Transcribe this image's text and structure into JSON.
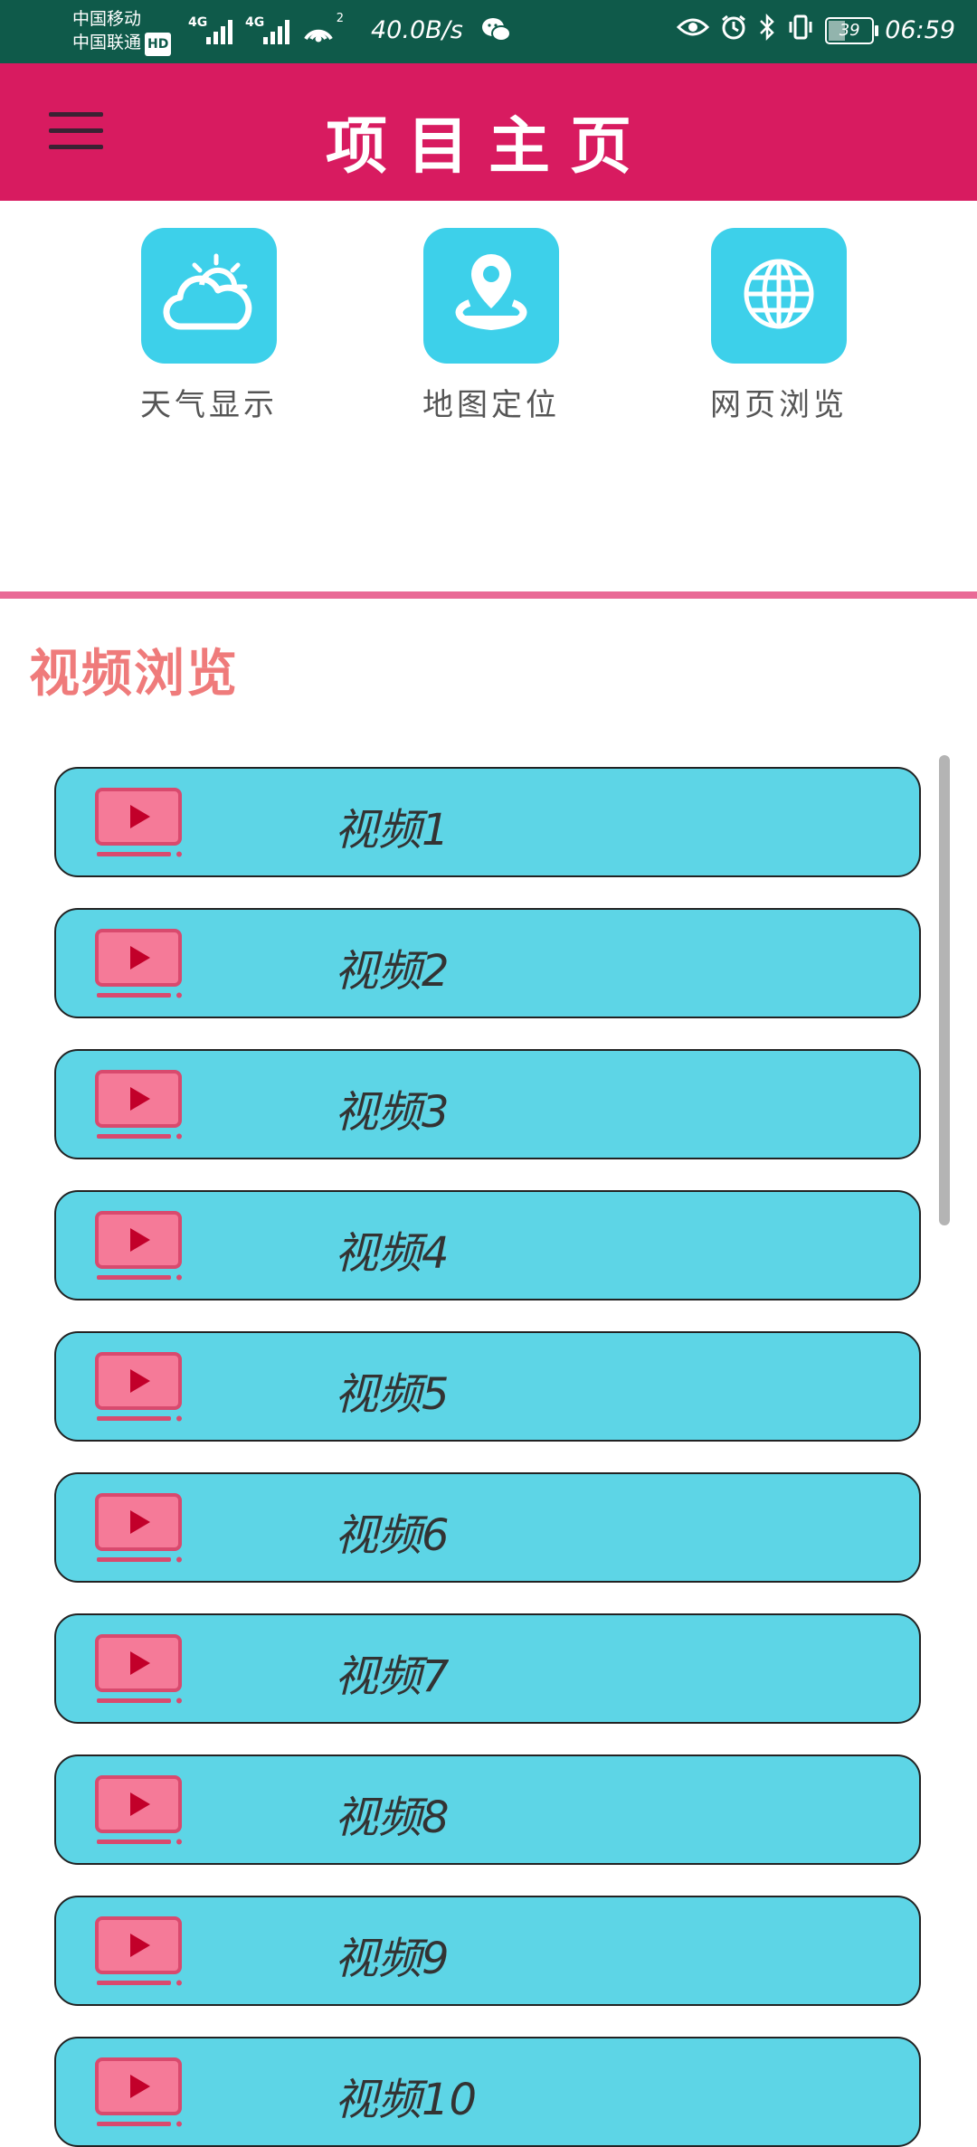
{
  "status_bar": {
    "carrier_1": "中国移动",
    "carrier_2": "中国联通",
    "hd_badge": "HD",
    "network_1": "4G",
    "network_2": "4G",
    "hotspot_count": "2",
    "speed": "40.0B/s",
    "battery": "39",
    "time": "06:59"
  },
  "app_bar": {
    "title": "项目主页"
  },
  "features": [
    {
      "label": "天气显示",
      "icon": "weather-icon"
    },
    {
      "label": "地图定位",
      "icon": "map-location-icon"
    },
    {
      "label": "网页浏览",
      "icon": "globe-icon"
    }
  ],
  "section": {
    "title": "视频浏览"
  },
  "videos": [
    {
      "label": "视频1"
    },
    {
      "label": "视频2"
    },
    {
      "label": "视频3"
    },
    {
      "label": "视频4"
    },
    {
      "label": "视频5"
    },
    {
      "label": "视频6"
    },
    {
      "label": "视频7"
    },
    {
      "label": "视频8"
    },
    {
      "label": "视频9"
    },
    {
      "label": "视频10"
    }
  ],
  "colors": {
    "status_bar": "#0f5a4a",
    "app_bar": "#d81b60",
    "tile": "#3dd0ea",
    "video_item": "#5dd5e6",
    "section_title": "#ef7b7b",
    "divider": "#e96a96"
  }
}
